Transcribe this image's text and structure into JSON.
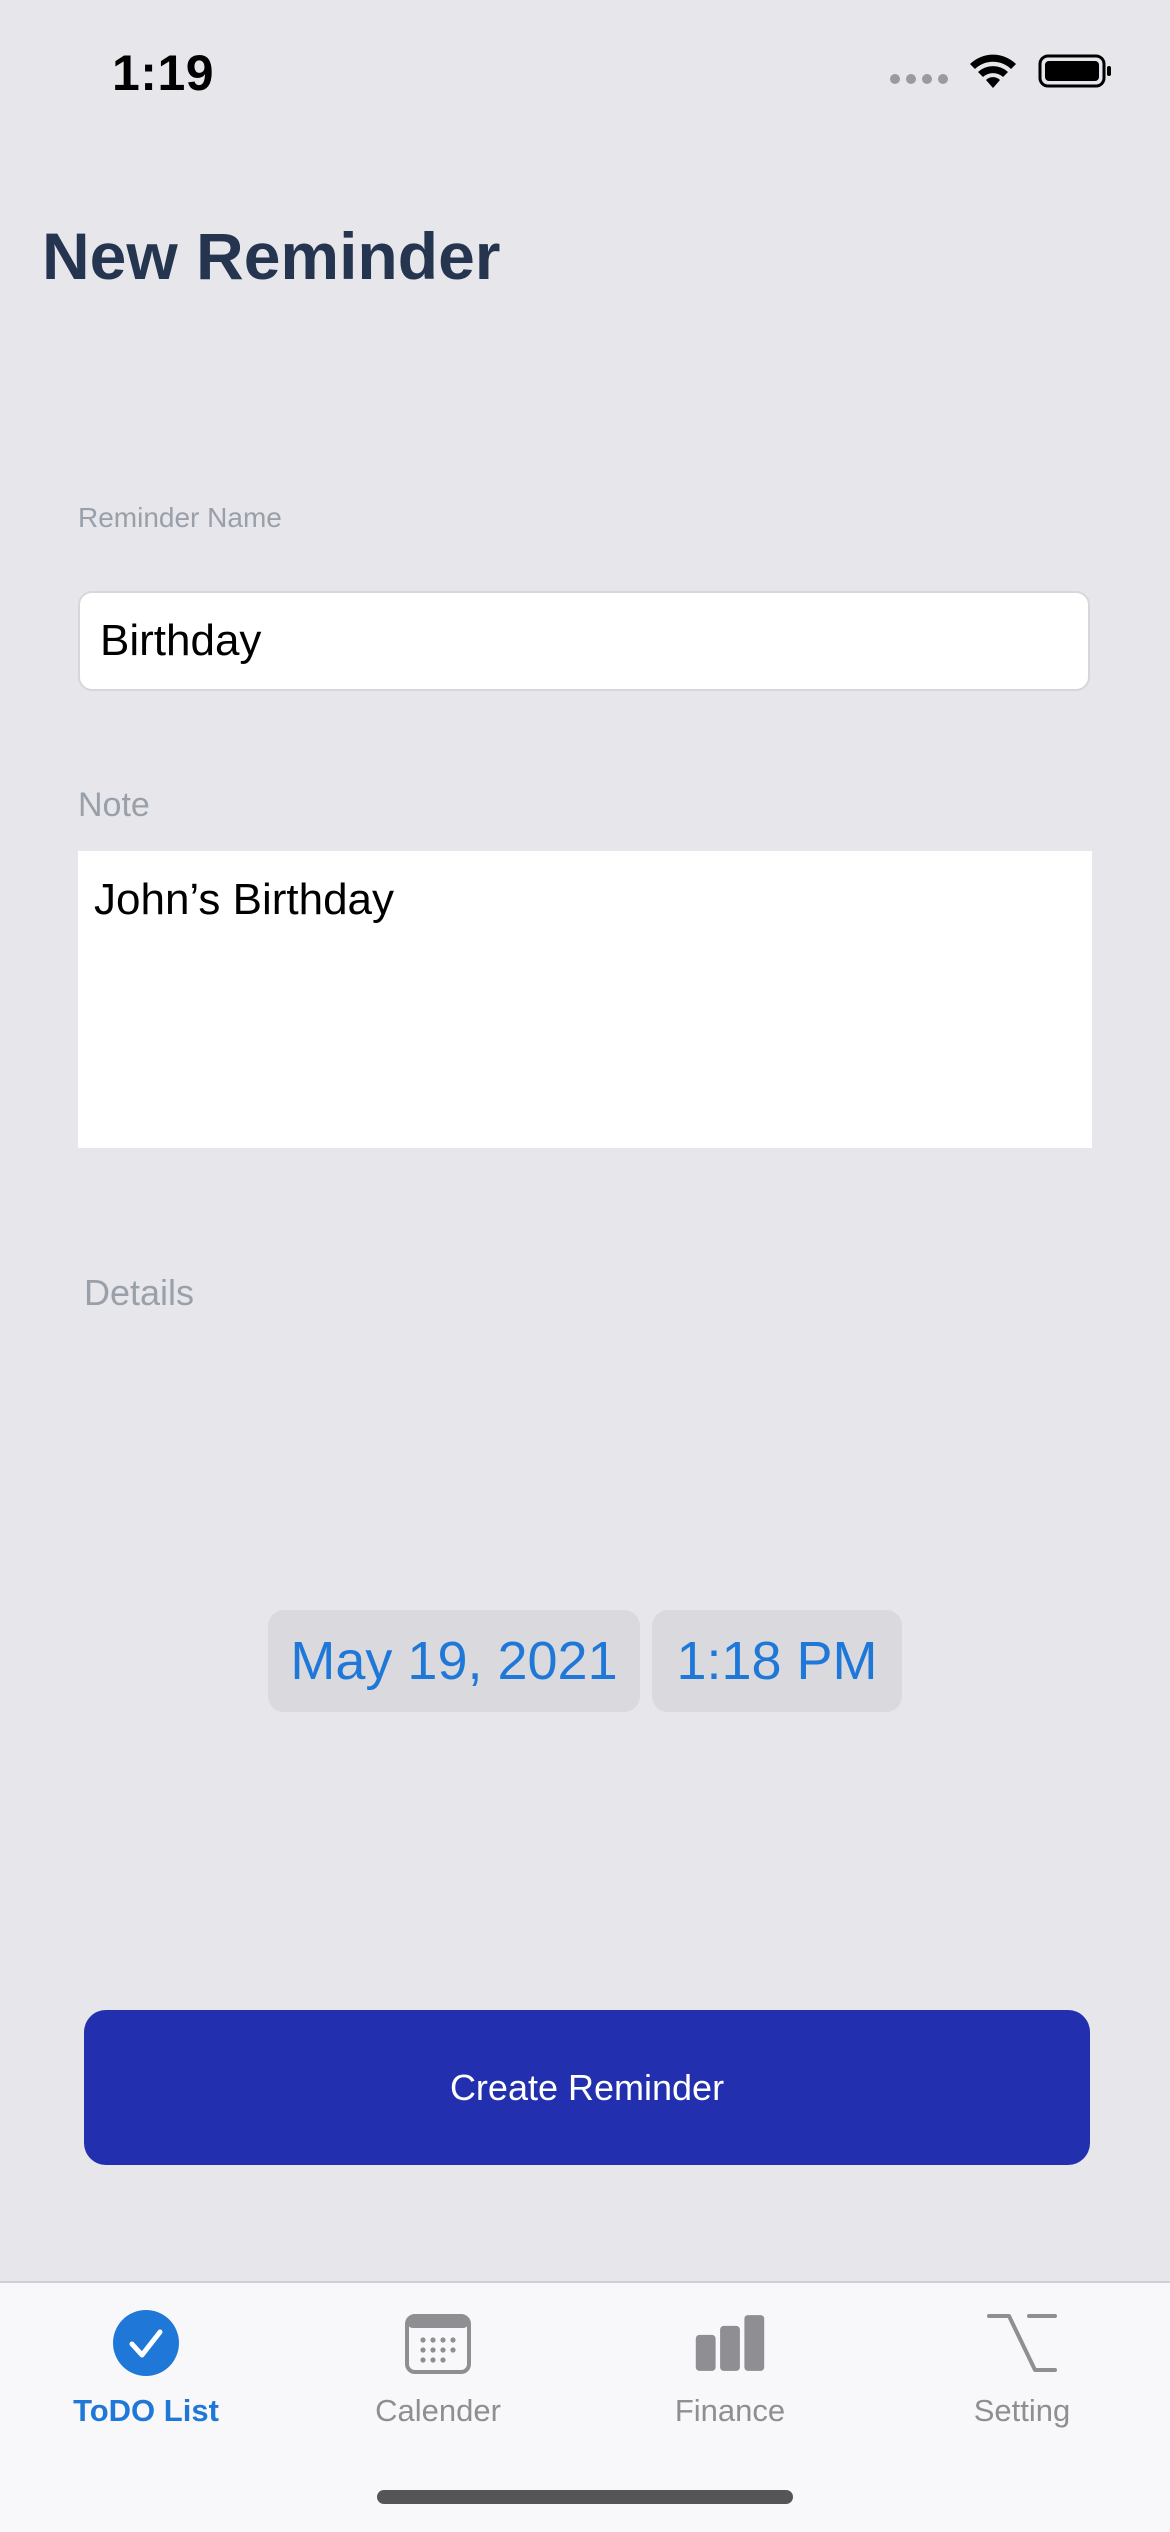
{
  "status_bar": {
    "time": "1:19"
  },
  "header": {
    "title": "New Reminder"
  },
  "form": {
    "name_label": "Reminder Name",
    "name_value": "Birthday",
    "note_label": "Note",
    "note_value": "John’s Birthday",
    "details_label": "Details",
    "date_value": "May 19, 2021",
    "time_value": "1:18 PM",
    "submit_label": "Create Reminder"
  },
  "tab_bar": {
    "items": [
      {
        "label": "ToDO List",
        "icon": "checkmark-circle-icon",
        "active": true
      },
      {
        "label": "Calender",
        "icon": "calendar-icon",
        "active": false
      },
      {
        "label": "Finance",
        "icon": "bar-chart-icon",
        "active": false
      },
      {
        "label": "Setting",
        "icon": "option-key-icon",
        "active": false
      }
    ]
  },
  "colors": {
    "background": "#e6e6eb",
    "title": "#25344f",
    "accent": "#1f78d8",
    "button": "#2230b0",
    "tab_inactive": "#8e8e93"
  }
}
